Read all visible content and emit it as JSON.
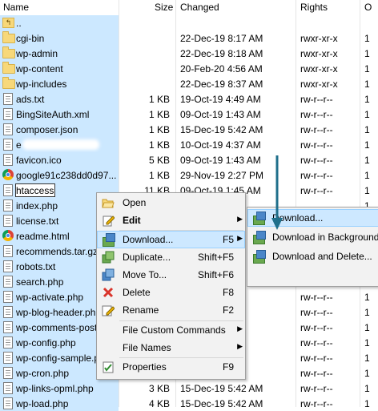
{
  "columns": {
    "name": "Name",
    "size": "Size",
    "changed": "Changed",
    "rights": "Rights",
    "owner": "O"
  },
  "files": [
    {
      "name": "..",
      "icon": "up-folder-icon",
      "size": "",
      "changed": "",
      "rights": "",
      "owner": ""
    },
    {
      "name": "cgi-bin",
      "icon": "folder-icon",
      "size": "",
      "changed": "22-Dec-19 8:17 AM",
      "rights": "rwxr-xr-x",
      "owner": "1"
    },
    {
      "name": "wp-admin",
      "icon": "folder-icon",
      "size": "",
      "changed": "22-Dec-19 8:18 AM",
      "rights": "rwxr-xr-x",
      "owner": "1"
    },
    {
      "name": "wp-content",
      "icon": "folder-icon",
      "size": "",
      "changed": "20-Feb-20 4:56 AM",
      "rights": "rwxr-xr-x",
      "owner": "1"
    },
    {
      "name": "wp-includes",
      "icon": "folder-icon",
      "size": "",
      "changed": "22-Dec-19 8:37 AM",
      "rights": "rwxr-xr-x",
      "owner": "1"
    },
    {
      "name": "ads.txt",
      "icon": "document-icon",
      "size": "1 KB",
      "changed": "19-Oct-19 4:49 AM",
      "rights": "rw-r--r--",
      "owner": "1"
    },
    {
      "name": "BingSiteAuth.xml",
      "icon": "document-icon",
      "size": "1 KB",
      "changed": "09-Oct-19 1:43 AM",
      "rights": "rw-r--r--",
      "owner": "1"
    },
    {
      "name": "composer.json",
      "icon": "document-icon",
      "size": "1 KB",
      "changed": "15-Dec-19 5:42 AM",
      "rights": "rw-r--r--",
      "owner": "1"
    },
    {
      "name": "e",
      "icon": "document-icon",
      "size": "1 KB",
      "changed": "10-Oct-19 4:37 AM",
      "rights": "rw-r--r--",
      "owner": "1"
    },
    {
      "name": "favicon.ico",
      "icon": "document-icon",
      "size": "5 KB",
      "changed": "09-Oct-19 1:43 AM",
      "rights": "rw-r--r--",
      "owner": "1"
    },
    {
      "name": "google91c238dd0d97...",
      "icon": "chrome-icon",
      "size": "1 KB",
      "changed": "29-Nov-19 2:27 PM",
      "rights": "rw-r--r--",
      "owner": "1"
    },
    {
      "name": "htaccess",
      "icon": "document-icon",
      "size": "11 KB",
      "changed": "09-Oct-19 1:45 AM",
      "rights": "rw-r--r--",
      "owner": "1"
    },
    {
      "name": "index.php",
      "icon": "document-icon",
      "size": "",
      "changed": "",
      "rights": "",
      "owner": "1"
    },
    {
      "name": "license.txt",
      "icon": "document-icon",
      "size": "",
      "changed": "",
      "rights": "",
      "owner": "1"
    },
    {
      "name": "readme.html",
      "icon": "chrome-icon",
      "size": "",
      "changed": "",
      "rights": "",
      "owner": "1"
    },
    {
      "name": "recommends.tar.gz",
      "icon": "document-icon",
      "size": "",
      "changed": "",
      "rights": "",
      "owner": "1"
    },
    {
      "name": "robots.txt",
      "icon": "document-icon",
      "size": "",
      "changed": "",
      "rights": "rw-r--r--",
      "owner": "1"
    },
    {
      "name": "search.php",
      "icon": "document-icon",
      "size": "",
      "changed": "",
      "rights": "rw-r--r--",
      "owner": "1"
    },
    {
      "name": "wp-activate.php",
      "icon": "document-icon",
      "size": "",
      "changed": "",
      "rights": "rw-r--r--",
      "owner": "1"
    },
    {
      "name": "wp-blog-header.php",
      "icon": "document-icon",
      "size": "",
      "changed": "",
      "rights": "rw-r--r--",
      "owner": "1"
    },
    {
      "name": "wp-comments-post.php",
      "icon": "document-icon",
      "size": "",
      "changed": "",
      "rights": "rw-r--r--",
      "owner": "1"
    },
    {
      "name": "wp-config.php",
      "icon": "document-icon",
      "size": "",
      "changed": "PM",
      "rights": "rw-r--r--",
      "owner": "1"
    },
    {
      "name": "wp-config-sample.php",
      "icon": "document-icon",
      "size": "",
      "changed": "AM",
      "rights": "rw-r--r--",
      "owner": "1"
    },
    {
      "name": "wp-cron.php",
      "icon": "document-icon",
      "size": "",
      "changed": "",
      "rights": "rw-r--r--",
      "owner": "1"
    },
    {
      "name": "wp-links-opml.php",
      "icon": "document-icon",
      "size": "3 KB",
      "changed": "15-Dec-19 5:42 AM",
      "rights": "rw-r--r--",
      "owner": "1"
    },
    {
      "name": "wp-load.php",
      "icon": "document-icon",
      "size": "4 KB",
      "changed": "15-Dec-19 5:42 AM",
      "rights": "rw-r--r--",
      "owner": "1"
    }
  ],
  "context_menu": {
    "items": [
      {
        "label": "Open",
        "shortcut": "",
        "submenu": false,
        "icon": "open-folder-icon"
      },
      {
        "label": "Edit",
        "shortcut": "",
        "submenu": true,
        "icon": "edit-icon",
        "bold": true
      },
      {
        "label": "Download...",
        "shortcut": "F5",
        "submenu": true,
        "icon": "download-icon",
        "highlighted": true
      },
      {
        "label": "Duplicate...",
        "shortcut": "Shift+F5",
        "submenu": false,
        "icon": "duplicate-icon"
      },
      {
        "label": "Move To...",
        "shortcut": "Shift+F6",
        "submenu": false,
        "icon": "move-icon"
      },
      {
        "label": "Delete",
        "shortcut": "F8",
        "submenu": false,
        "icon": "delete-icon"
      },
      {
        "label": "Rename",
        "shortcut": "F2",
        "submenu": false,
        "icon": "rename-icon"
      },
      {
        "label": "File Custom Commands",
        "shortcut": "",
        "submenu": true,
        "icon": ""
      },
      {
        "label": "File Names",
        "shortcut": "",
        "submenu": true,
        "icon": ""
      },
      {
        "label": "Properties",
        "shortcut": "F9",
        "submenu": false,
        "icon": "properties-icon"
      }
    ]
  },
  "download_submenu": {
    "items": [
      {
        "label": "Download...",
        "icon": "download-icon",
        "highlighted": true
      },
      {
        "label": "Download in Background",
        "icon": "download-background-icon"
      },
      {
        "label": "Download and Delete...",
        "icon": "download-delete-icon"
      }
    ]
  },
  "colors": {
    "selection": "#cce8ff",
    "menu_highlight": "#cde8ff",
    "arrow": "#1f6f8b"
  }
}
